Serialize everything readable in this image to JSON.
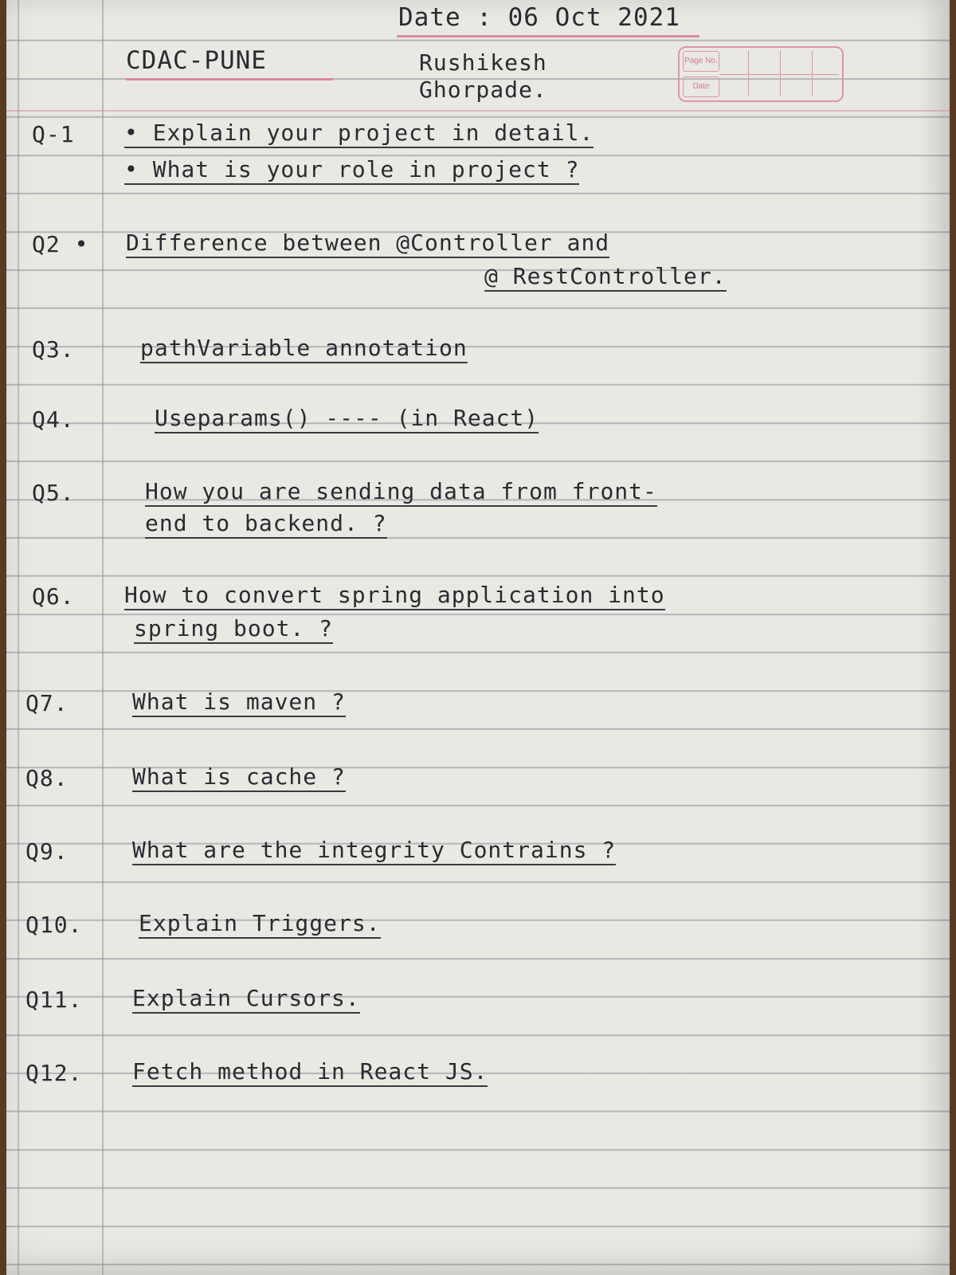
{
  "header": {
    "date_label": "Date : 06 Oct 2021",
    "institute": "CDAC-PUNE",
    "name_line1": "Rushikesh",
    "name_line2": "Ghorpade.",
    "page_no_label": "Page No.",
    "date_box_label": "Date"
  },
  "questions": [
    {
      "num": "Q-1",
      "lines": [
        "• Explain your project in detail.",
        "• What is your role in project ?"
      ]
    },
    {
      "num": "Q2 •",
      "lines": [
        "Difference between @Controller and",
        "@ RestController."
      ]
    },
    {
      "num": "Q3.",
      "lines": [
        "pathVariable annotation"
      ]
    },
    {
      "num": "Q4.",
      "lines": [
        "Useparams()   ----  (in React)"
      ]
    },
    {
      "num": "Q5.",
      "lines": [
        "How you are sending data from front-",
        "end to backend. ?"
      ]
    },
    {
      "num": "Q6.",
      "lines": [
        "How to convert spring application into",
        "spring boot. ?"
      ]
    },
    {
      "num": "Q7.",
      "lines": [
        "What is maven ?"
      ]
    },
    {
      "num": "Q8.",
      "lines": [
        "What is cache ?"
      ]
    },
    {
      "num": "Q9.",
      "lines": [
        "What are the integrity Contrains ?"
      ]
    },
    {
      "num": "Q10.",
      "lines": [
        "Explain Triggers."
      ]
    },
    {
      "num": "Q11.",
      "lines": [
        "Explain Cursors."
      ]
    },
    {
      "num": "Q12.",
      "lines": [
        "Fetch method in React JS."
      ]
    }
  ]
}
